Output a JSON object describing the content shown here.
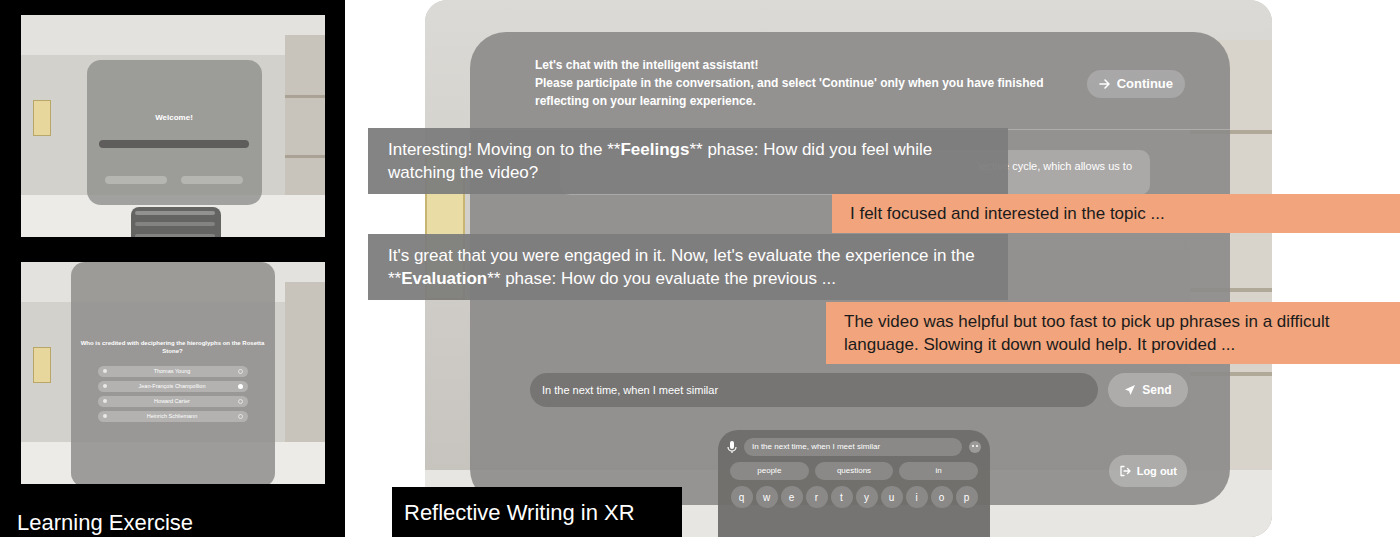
{
  "learning_exercise": {
    "label": "Learning Exercise",
    "welcome_title": "Welcome!",
    "quiz": {
      "question": "Who is credited with deciphering the hieroglyphs on the Rosetta Stone?",
      "options": [
        {
          "label": "Thomas Young",
          "selected": false
        },
        {
          "label": "Jean-François Champollion",
          "selected": true
        },
        {
          "label": "Howard Carter",
          "selected": false
        },
        {
          "label": "Heinrich Schliemann",
          "selected": false
        }
      ]
    }
  },
  "reflective_writing": {
    "label": "Reflective Writing in XR",
    "header": {
      "title": "Let's chat with the intelligent assistant!",
      "instructions": "Please participate in the conversation, and select 'Continue' only when you have finished reflecting on your learning experience.",
      "continue_button": "Continue"
    },
    "background_message": "lective cycle, which allows us to",
    "messages": [
      {
        "kind": "assistant",
        "parts": [
          {
            "text": "Interesting! Moving on to the **",
            "bold": false
          },
          {
            "text": "Feelings",
            "bold": true
          },
          {
            "text": "** phase: How did you feel while watching the video?",
            "bold": false
          }
        ]
      },
      {
        "kind": "user",
        "parts": [
          {
            "text": "I felt focused and interested in the topic ...",
            "bold": false
          }
        ]
      },
      {
        "kind": "assistant",
        "parts": [
          {
            "text": "It's great that you were engaged in it. Now, let's evaluate the experience in the **",
            "bold": false
          },
          {
            "text": "Evaluation",
            "bold": true
          },
          {
            "text": "** phase: How do you evaluate the previous ...",
            "bold": false
          }
        ]
      },
      {
        "kind": "user",
        "parts": [
          {
            "text": "The video was helpful but too fast to pick up phrases in a difficult language. Slowing it down would help. It provided ...",
            "bold": false
          }
        ]
      }
    ],
    "input": {
      "value": "In the next time, when I meet similar"
    },
    "send_button": "Send",
    "logout_button": "Log out",
    "keyboard": {
      "field_text": "In the next time, when I meet similar",
      "suggestions": [
        "people",
        "questions",
        "in"
      ],
      "keys": [
        "q",
        "w",
        "e",
        "r",
        "t",
        "y",
        "u",
        "i",
        "o",
        "p"
      ]
    }
  }
}
